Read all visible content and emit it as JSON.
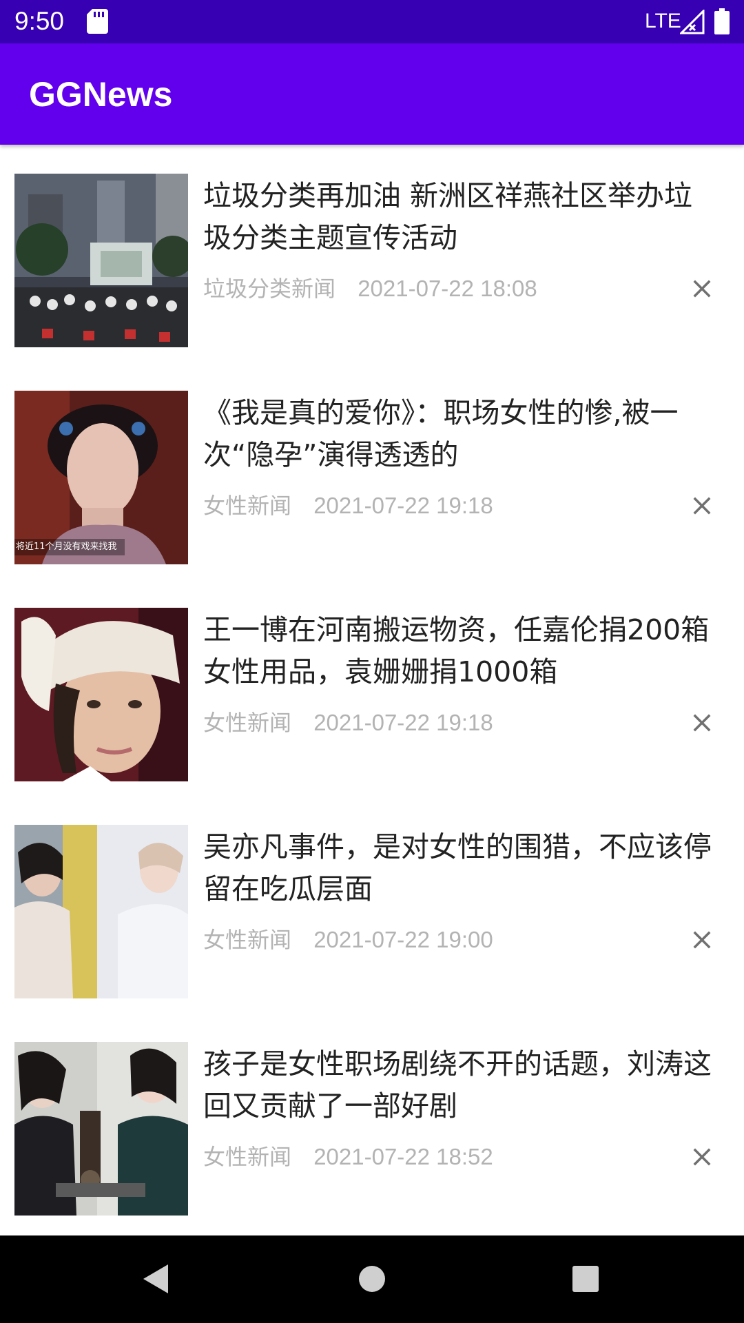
{
  "status_bar": {
    "time": "9:50",
    "network": "LTE",
    "icons": [
      "sd-card-icon",
      "signal-icon",
      "battery-icon"
    ]
  },
  "app_bar": {
    "title": "GGNews"
  },
  "news": [
    {
      "title": "垃圾分类再加油 新洲区祥燕社区举办垃圾分类主题宣传活动",
      "category": "垃圾分类新闻",
      "date": "2021-07-22 18:08",
      "thumb": "outdoor-movie-screening-photo"
    },
    {
      "title": "《我是真的爱你》：职场女性的惨,被一次“隐孕”演得透透的",
      "category": "女性新闻",
      "date": "2021-07-22 19:18",
      "thumb": "actress-portrait-photo",
      "thumb_caption": "将近11个月没有戏来找我"
    },
    {
      "title": "王一博在河南搬运物资，任嘉伦捐200箱女性用品，袁姗姗捐1000箱",
      "category": "女性新闻",
      "date": "2021-07-22 19:18",
      "thumb": "man-beanie-portrait-photo"
    },
    {
      "title": "吴亦凡事件，是对女性的围猎，不应该停留在吃瓜层面",
      "category": "女性新闻",
      "date": "2021-07-22 19:00",
      "thumb": "two-people-photo"
    },
    {
      "title": "孩子是女性职场剧绕不开的话题，刘涛这回又贡献了一部好剧",
      "category": "女性新闻",
      "date": "2021-07-22 18:52",
      "thumb": "drama-scene-photo"
    }
  ],
  "nav_bar": {
    "buttons": [
      "back-icon",
      "home-icon",
      "recents-icon"
    ]
  },
  "colors": {
    "status_bar": "#3700b3",
    "app_bar": "#6200ee",
    "meta_text": "#b3b3b3",
    "title_text": "#222222"
  }
}
